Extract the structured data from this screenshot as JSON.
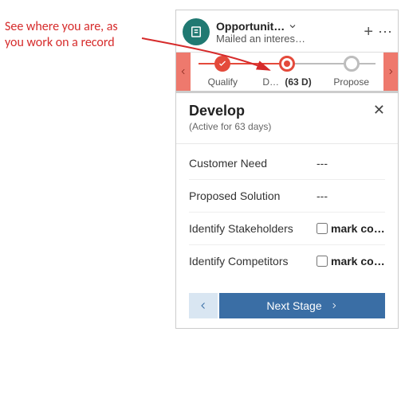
{
  "annotation": {
    "line1": "See where you are, as",
    "line2": "you work on a record"
  },
  "header": {
    "entity": "Opportunit…",
    "subtitle": "Mailed an interes…"
  },
  "bpf": {
    "stages": [
      {
        "label": "Qualify",
        "state": "complete"
      },
      {
        "label": "D…",
        "duration": "(63 D)",
        "state": "active"
      },
      {
        "label": "Propose",
        "state": "future"
      }
    ]
  },
  "stageCard": {
    "name": "Develop",
    "sub": "(Active for 63 days)"
  },
  "fields": {
    "text": [
      {
        "label": "Customer Need",
        "value": "---"
      },
      {
        "label": "Proposed Solution",
        "value": "---"
      }
    ],
    "check": [
      {
        "label": "Identify Stakeholders",
        "value": "mark co…"
      },
      {
        "label": "Identify Competitors",
        "value": "mark co…"
      }
    ]
  },
  "footer": {
    "next": "Next Stage"
  }
}
